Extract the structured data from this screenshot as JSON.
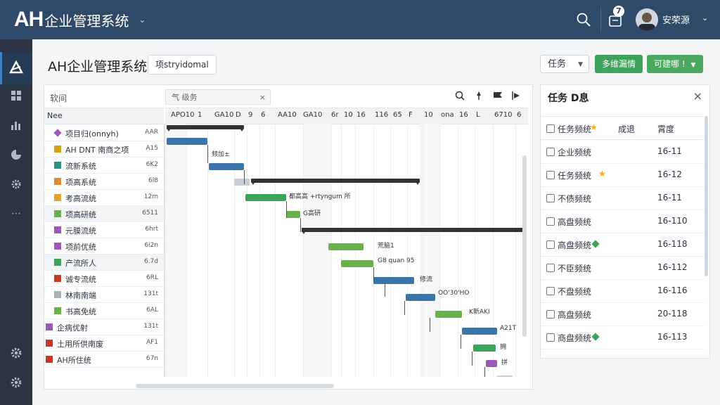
{
  "app": {
    "logo": "AH",
    "title": "企业管理系统",
    "notifications": "7",
    "username": "安荣源"
  },
  "page": {
    "title": "AH企业管理系统",
    "tag": "项stryidomal",
    "task_select": "任务",
    "btn_primary": "多维漏情",
    "btn_secondary": "可建哪 !"
  },
  "gantt": {
    "search_label": "软间",
    "search_placeholder": "气 级务",
    "name_header": "Nee",
    "columns": [
      "APO10",
      "1",
      "GA10",
      "D",
      "9",
      "6",
      "AA10",
      "GA10",
      "6r",
      "10",
      "16",
      "116",
      "65",
      "F",
      "10",
      "ona",
      "16",
      "L",
      "6710",
      "6"
    ],
    "rows": [
      {
        "name": "项目归(onnyh)",
        "date": "AAR",
        "color": "#9b59b6"
      },
      {
        "name": "AH DNT 南商之项",
        "date": "A15",
        "color": "#d4a017"
      },
      {
        "name": "流新系统",
        "date": "6K2",
        "color": "#2f8f85"
      },
      {
        "name": "项高系统",
        "date": "6l8",
        "color": "#e08a2c"
      },
      {
        "name": "考高流统",
        "date": "12m",
        "color": "#e0a52c"
      },
      {
        "name": "项高研统",
        "date": "6511",
        "color": "#6ab04c"
      },
      {
        "name": "元膜流统",
        "date": "6hrt",
        "color": "#9b59b6"
      },
      {
        "name": "项前优统",
        "date": "6i2n",
        "color": "#9b59b6"
      },
      {
        "name": "产流所人",
        "date": "6.7d",
        "color": "#3ea35a"
      },
      {
        "name": "诚专流统",
        "date": "6RL",
        "color": "#c0392b"
      },
      {
        "name": "林南南端",
        "date": "131t",
        "color": "#aab2bb"
      },
      {
        "name": "书高免统",
        "date": "6AL",
        "color": "#6ab04c"
      },
      {
        "name": "企病优射",
        "date": "131t",
        "color": "#9b59b6"
      },
      {
        "name": "土用所供南废",
        "date": "AF1",
        "color": "#c0392b"
      },
      {
        "name": "AH所住统",
        "date": "67n",
        "color": "#c0392b"
      }
    ],
    "bar_labels": [
      "频加±",
      "都高高 +rtyngum 所",
      "G高研",
      "荒脑1",
      "G8 quan 95",
      "修流",
      "OO'30'HO",
      "K新AKI",
      "A21T",
      "拥",
      "拼"
    ]
  },
  "detail": {
    "title": "任务 D息",
    "col1": "任务频统",
    "col2": "成退",
    "col3": "霄度",
    "rows": [
      {
        "name": "企业频统",
        "value": "16-11",
        "mark": ""
      },
      {
        "name": "任务频统",
        "value": "16-12",
        "mark": "star"
      },
      {
        "name": "不债频统",
        "value": "16-11",
        "mark": ""
      },
      {
        "name": "高盘频统",
        "value": "16-110",
        "mark": ""
      },
      {
        "name": "高盘频统",
        "value": "16-118",
        "mark": "diamond"
      },
      {
        "name": "不臣频统",
        "value": "16-112",
        "mark": ""
      },
      {
        "name": "不盘频统",
        "value": "16-116",
        "mark": ""
      },
      {
        "name": "高盘频统",
        "value": "20-118",
        "mark": ""
      },
      {
        "name": "商盘频统",
        "value": "16-113",
        "mark": "diamond"
      }
    ]
  }
}
